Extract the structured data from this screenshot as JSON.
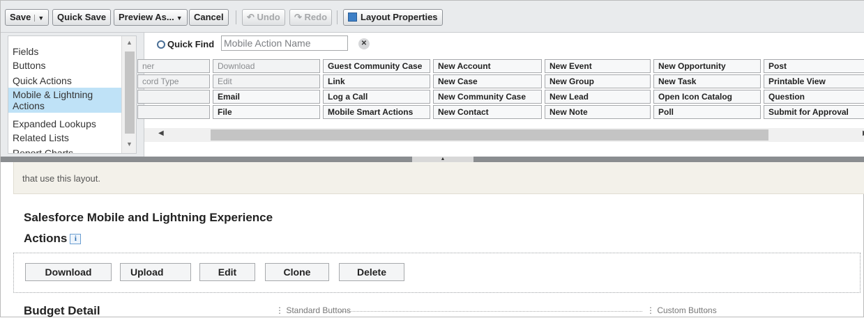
{
  "toolbar": {
    "save_label": "Save",
    "quick_save_label": "Quick Save",
    "preview_label": "Preview As...",
    "cancel_label": "Cancel",
    "undo_label": "Undo",
    "redo_label": "Redo",
    "layout_properties_label": "Layout Properties"
  },
  "palette": {
    "categories": [
      {
        "label": "Fields"
      },
      {
        "label": "Buttons"
      },
      {
        "label": "Quick Actions"
      },
      {
        "label": "Mobile & Lightning Actions",
        "selected": true
      },
      {
        "label": "Expanded Lookups"
      },
      {
        "label": "Related Lists"
      },
      {
        "label": "Report Charts"
      }
    ],
    "quick_find_label": "Quick Find",
    "quick_find_placeholder": "Mobile Action Name",
    "grid": [
      [
        "ner",
        "Download",
        "Guest Community Case",
        "New Account",
        "New Event",
        "New Opportunity",
        "Post"
      ],
      [
        "cord Type",
        "Edit",
        "Link",
        "New Case",
        "New Group",
        "New Task",
        "Printable View"
      ],
      [
        "",
        "Email",
        "Log a Call",
        "New Community Case",
        "New Lead",
        "Open Icon Catalog",
        "Question"
      ],
      [
        "",
        "File",
        "Mobile Smart Actions",
        "New Contact",
        "New Note",
        "Poll",
        "Submit for Approval"
      ]
    ],
    "used_cells": [
      [
        0,
        0
      ],
      [
        0,
        1
      ],
      [
        1,
        0
      ],
      [
        1,
        1
      ]
    ]
  },
  "canvas": {
    "note_text": "that use this layout.",
    "section_title_line1": "Salesforce Mobile and Lightning Experience",
    "section_title_line2": "Actions",
    "info_icon_text": "i",
    "action_buttons": [
      "Download",
      "Upload",
      "Edit",
      "Clone",
      "Delete"
    ],
    "budget_title": "Budget Detail",
    "standard_buttons_label": "Standard Buttons",
    "custom_buttons_label": "Custom Buttons"
  },
  "colors": {
    "selected_category": "#bfe2f7",
    "toolbar_bg": "#e9ebed",
    "divider": "#8a8d90",
    "note_bg": "#f3f1ea"
  }
}
